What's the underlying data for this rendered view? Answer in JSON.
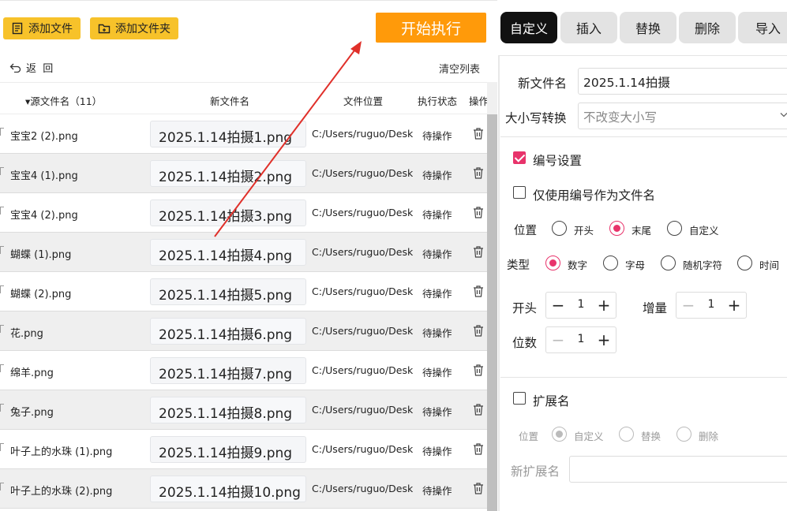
{
  "toolbar": {
    "add_file_label": "添加文件",
    "add_folder_label": "添加文件夹",
    "start_label": "开始执行",
    "back_label": "返  回",
    "clear_label": "清空列表"
  },
  "table": {
    "columns": {
      "source": "▾源文件名（11）",
      "new_name": "新文件名",
      "location": "文件位置",
      "status": "执行状态",
      "action": "操作"
    },
    "rows": [
      {
        "source": "宝宝2 (2).png",
        "new_name": "2025.1.14拍摄1.png",
        "location": "C:/Users/ruguo/Desktop",
        "status": "待操作"
      },
      {
        "source": "宝宝4 (1).png",
        "new_name": "2025.1.14拍摄2.png",
        "location": "C:/Users/ruguo/Desktop",
        "status": "待操作"
      },
      {
        "source": "宝宝4 (2).png",
        "new_name": "2025.1.14拍摄3.png",
        "location": "C:/Users/ruguo/Desktop",
        "status": "待操作"
      },
      {
        "source": "蝴蝶 (1).png",
        "new_name": "2025.1.14拍摄4.png",
        "location": "C:/Users/ruguo/Desktop",
        "status": "待操作"
      },
      {
        "source": "蝴蝶 (2).png",
        "new_name": "2025.1.14拍摄5.png",
        "location": "C:/Users/ruguo/Desktop",
        "status": "待操作"
      },
      {
        "source": "花.png",
        "new_name": "2025.1.14拍摄6.png",
        "location": "C:/Users/ruguo/Desktop",
        "status": "待操作"
      },
      {
        "source": "绵羊.png",
        "new_name": "2025.1.14拍摄7.png",
        "location": "C:/Users/ruguo/Desktop",
        "status": "待操作"
      },
      {
        "source": "兔子.png",
        "new_name": "2025.1.14拍摄8.png",
        "location": "C:/Users/ruguo/Desktop",
        "status": "待操作"
      },
      {
        "source": "叶子上的水珠 (1).png",
        "new_name": "2025.1.14拍摄9.png",
        "location": "C:/Users/ruguo/Desktop",
        "status": "待操作"
      },
      {
        "source": "叶子上的水珠 (2).png",
        "new_name": "2025.1.14拍摄10.png",
        "location": "C:/Users/ruguo/Desktop",
        "status": "待操作"
      }
    ]
  },
  "tabs": [
    {
      "label": "自定义",
      "active": true
    },
    {
      "label": "插入",
      "active": false
    },
    {
      "label": "替换",
      "active": false
    },
    {
      "label": "删除",
      "active": false
    },
    {
      "label": "导入",
      "active": false
    }
  ],
  "settings": {
    "new_name_label": "新文件名",
    "new_name_value": "2025.1.14拍摄",
    "case_label": "大小写转换",
    "case_value": "不改变大小写",
    "numbering_label": "编号设置",
    "numbering_checked": true,
    "only_number_label": "仅使用编号作为文件名",
    "only_number_checked": false,
    "position_label": "位置",
    "position_options": [
      "开头",
      "末尾",
      "自定义"
    ],
    "position_selected": "末尾",
    "type_label": "类型",
    "type_options": [
      "数字",
      "字母",
      "随机字符",
      "时间"
    ],
    "type_selected": "数字",
    "start_label": "开头",
    "start_value": "1",
    "increment_label": "增量",
    "increment_value": "1",
    "digits_label": "位数",
    "digits_value": "1",
    "extension_label": "扩展名",
    "extension_checked": false,
    "ext_position_label": "位置",
    "ext_position_options": [
      "自定义",
      "替换",
      "删除"
    ],
    "ext_position_selected": "自定义",
    "new_ext_label": "新扩展名",
    "new_ext_value": ""
  },
  "colors": {
    "accent": "#e8336b",
    "start_button": "#ff9a0a",
    "toolbar_button": "#f7c22a",
    "arrow": "#e0302a"
  }
}
